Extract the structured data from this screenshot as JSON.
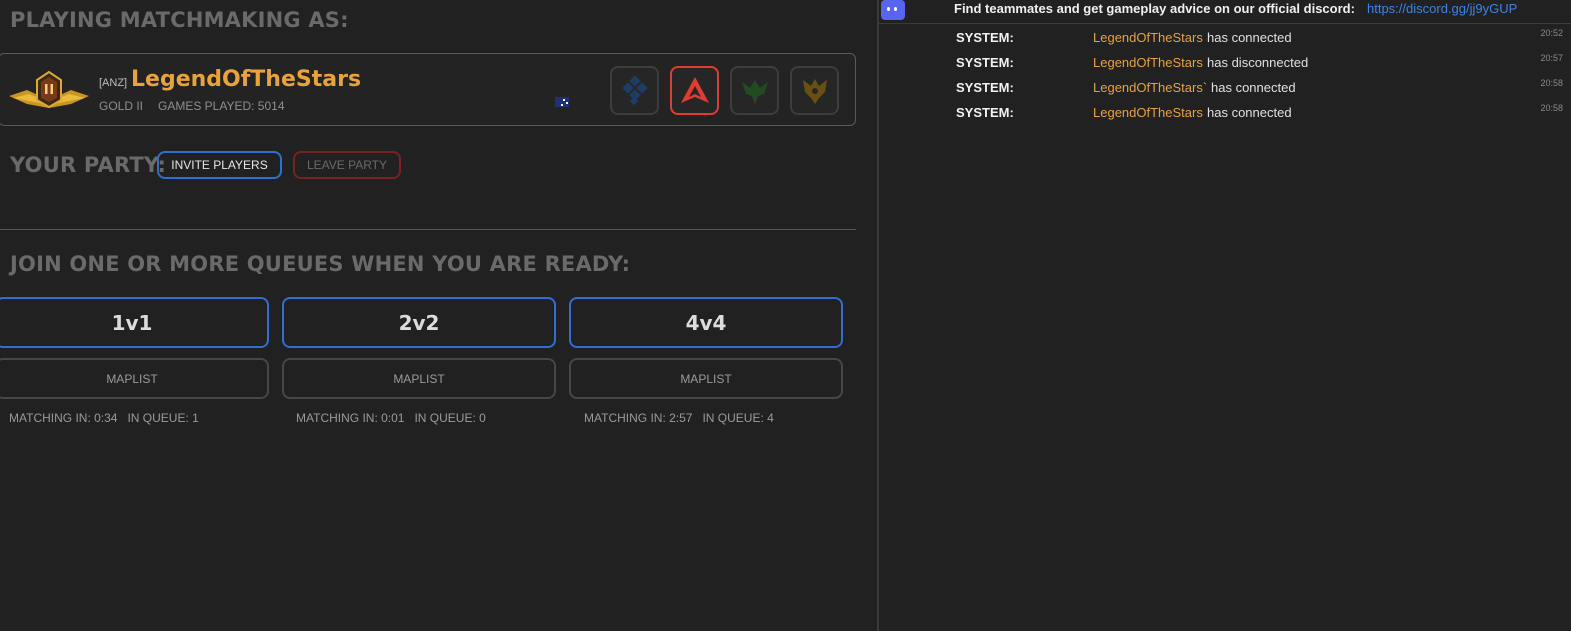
{
  "left_panel": {
    "playing_title": "PLAYING MATCHMAKING AS:",
    "player": {
      "region": "[ANZ]",
      "name": "LegendOfTheStars",
      "rank": "GOLD II",
      "games_played_label": "GAMES PLAYED: 5014",
      "rank_emblem_icon": "gold-ii-rank-emblem",
      "country_flag_icon": "australia-flag-icon"
    },
    "factions": [
      {
        "icon": "diamond-faction-icon",
        "active": false
      },
      {
        "icon": "triangle-faction-icon",
        "active": true
      },
      {
        "icon": "green-insect-faction-icon",
        "active": false
      },
      {
        "icon": "gold-insect-faction-icon",
        "active": false
      }
    ],
    "party_title": "YOUR PARTY:",
    "invite_label": "INVITE PLAYERS",
    "leave_label": "LEAVE PARTY",
    "join_title": "JOIN ONE OR MORE QUEUES WHEN YOU ARE READY:",
    "queues": [
      {
        "mode": "1v1",
        "maplist": "MAPLIST",
        "info": "MATCHING IN: 0:34   IN QUEUE: 1"
      },
      {
        "mode": "2v2",
        "maplist": "MAPLIST",
        "info": "MATCHING IN: 0:01   IN QUEUE: 0"
      },
      {
        "mode": "4v4",
        "maplist": "MAPLIST",
        "info": "MATCHING IN: 2:57   IN QUEUE: 4"
      }
    ]
  },
  "chat": {
    "header_text": "Find teammates and get gameplay advice on our official discord:",
    "header_link": "https://discord.gg/jj9yGUP",
    "messages": [
      {
        "sender": "SYSTEM:",
        "user": "LegendOfTheStars",
        "text": " has connected",
        "time": "20:52"
      },
      {
        "sender": "SYSTEM:",
        "user": "LegendOfTheStars",
        "text": " has disconnected",
        "time": "20:57"
      },
      {
        "sender": "SYSTEM:",
        "user": "LegendOfTheStars`",
        "text": " has connected",
        "time": "20:58"
      },
      {
        "sender": "SYSTEM:",
        "user": "LegendOfTheStars",
        "text": " has connected",
        "time": "20:58"
      }
    ]
  },
  "colors": {
    "accent_blue": "#2f6fd0",
    "name_orange": "#e8a33a",
    "active_red": "#e03c32",
    "leave_red": "#7a2222",
    "link_blue": "#3f83e6"
  }
}
